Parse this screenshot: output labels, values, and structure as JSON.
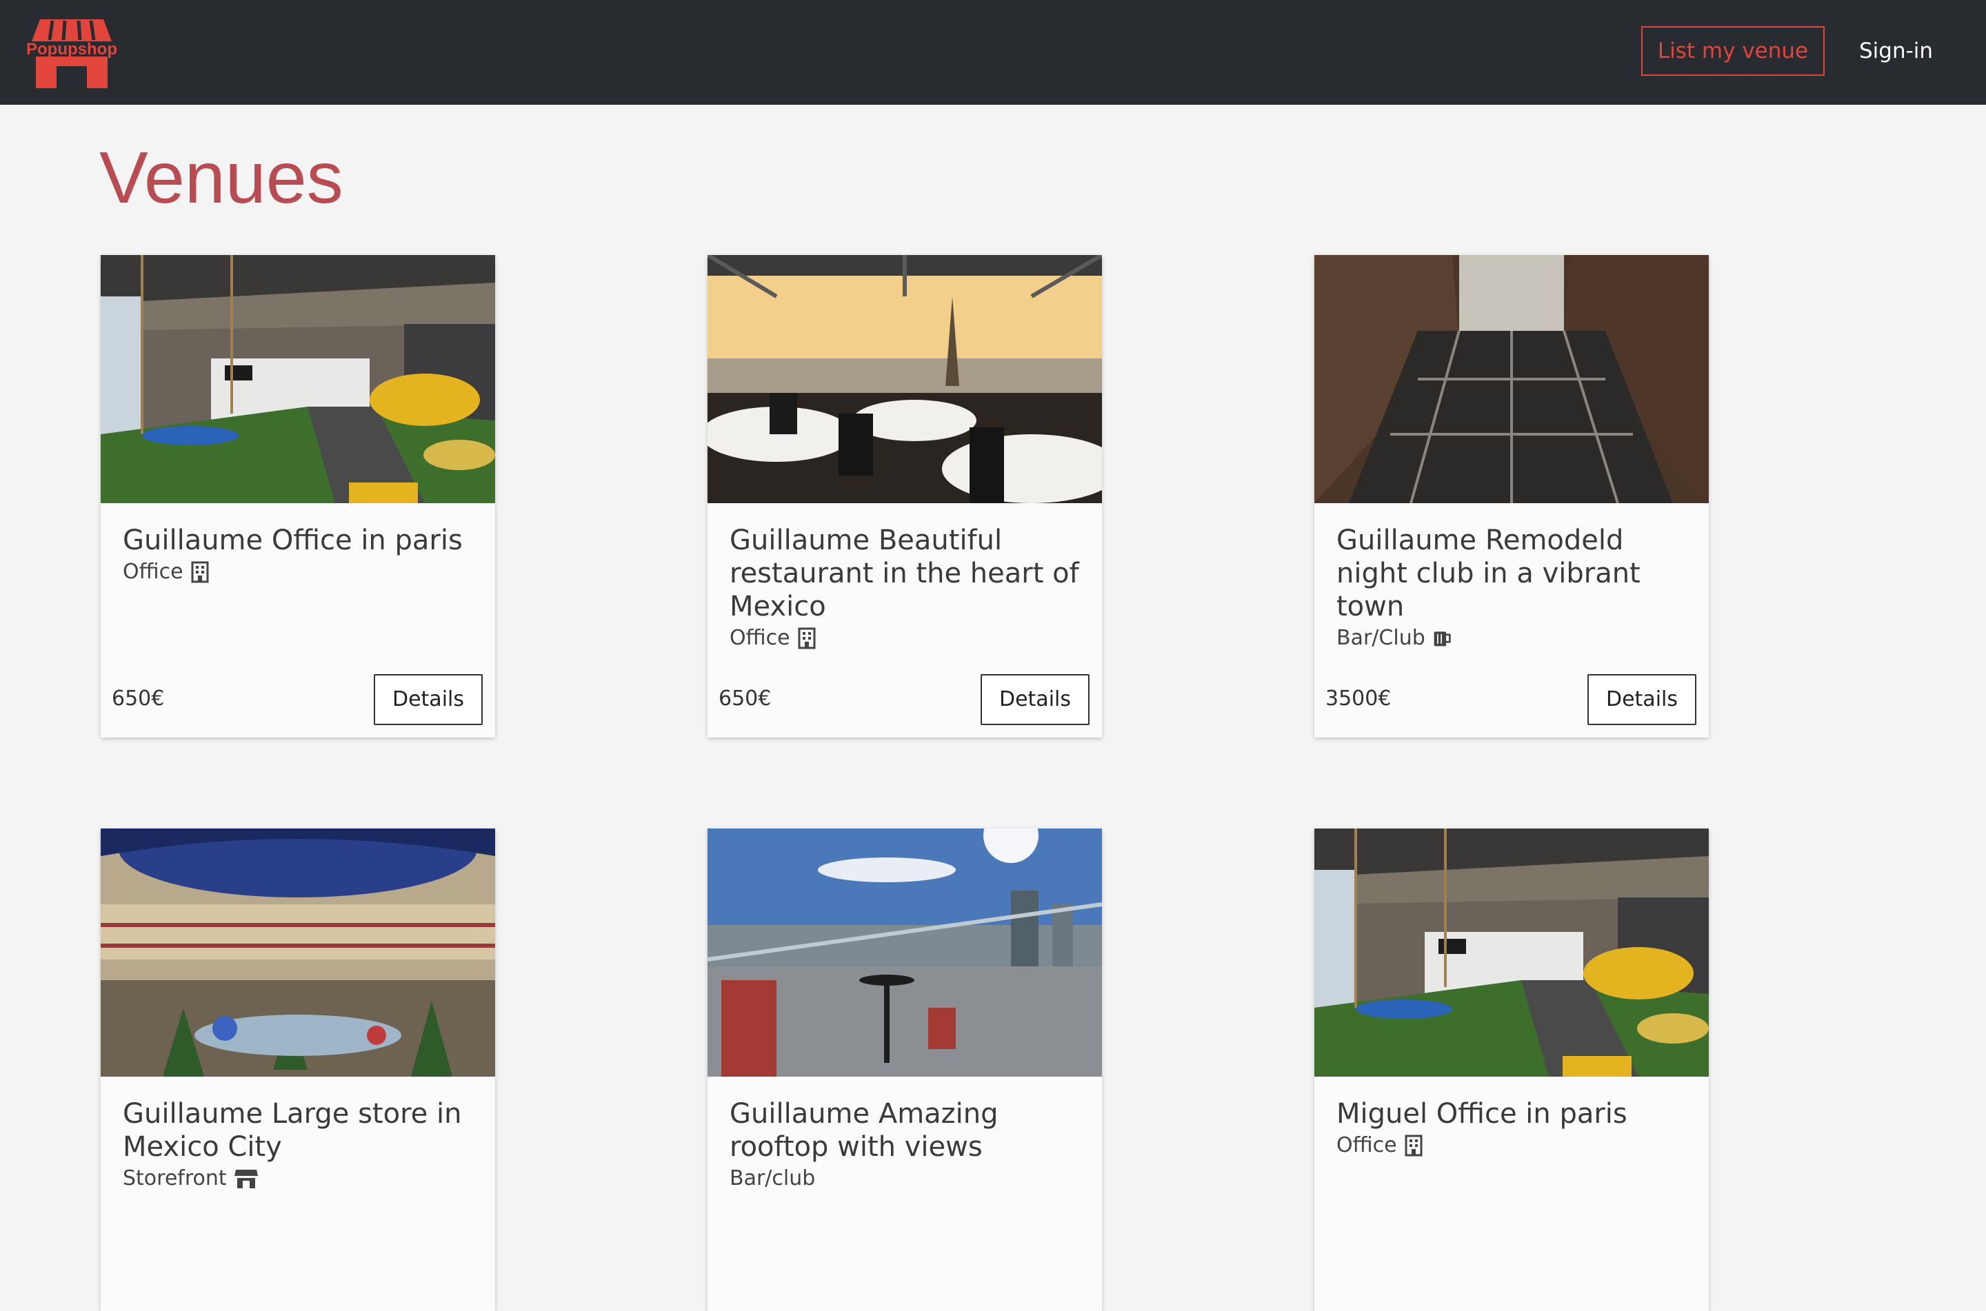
{
  "nav": {
    "brand": "Popupshop",
    "list_venue": "List my venue",
    "signin": "Sign-in"
  },
  "page": {
    "title": "Venues"
  },
  "colors": {
    "accent": "#e2453b",
    "title": "#b84c52",
    "navbar": "#282b30"
  },
  "venues": [
    {
      "name": "Guillaume Office in paris",
      "category": "Office",
      "icon": "building-icon",
      "price": "650€",
      "details": "Details"
    },
    {
      "name": "Guillaume Beautiful restaurant in the heart of Mexico",
      "category": "Office",
      "icon": "building-icon",
      "price": "650€",
      "details": "Details"
    },
    {
      "name": "Guillaume Remodeld night club in a vibrant town",
      "category": "Bar/Club",
      "icon": "beer-mug-icon",
      "price": "3500€",
      "details": "Details"
    },
    {
      "name": "Guillaume Large store in Mexico City",
      "category": "Storefront",
      "icon": "store-icon"
    },
    {
      "name": "Guillaume Amazing rooftop with views",
      "category": "Bar/club"
    },
    {
      "name": "Miguel Office in paris",
      "category": "Office",
      "icon": "building-icon"
    }
  ]
}
